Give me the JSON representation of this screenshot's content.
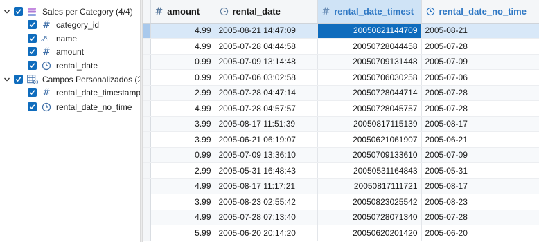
{
  "tree": {
    "groups": [
      {
        "label": "Sales per Category (4/4)",
        "fields": [
          {
            "label": "category_id",
            "icon": "hash-icon"
          },
          {
            "label": "name",
            "icon": "text-abc-icon"
          },
          {
            "label": "amount",
            "icon": "hash-icon"
          },
          {
            "label": "rental_date",
            "icon": "clock-icon"
          }
        ]
      },
      {
        "label": "Campos Personalizados (2/",
        "fields": [
          {
            "label": "rental_date_timestamp",
            "icon": "hash-icon"
          },
          {
            "label": "rental_date_no_time",
            "icon": "clock-icon"
          }
        ]
      }
    ]
  },
  "grid": {
    "columns": [
      {
        "label": "amount",
        "icon": "hash-icon"
      },
      {
        "label": "rental_date",
        "icon": "clock-icon"
      },
      {
        "label": "rental_date_timest",
        "icon": "hash-icon"
      },
      {
        "label": "rental_date_no_time",
        "icon": "clock-icon"
      }
    ],
    "rows": [
      [
        "4.99",
        "2005-08-21 14:47:09",
        "20050821144709",
        "2005-08-21"
      ],
      [
        "4.99",
        "2005-07-28 04:44:58",
        "20050728044458",
        "2005-07-28"
      ],
      [
        "0.99",
        "2005-07-09 13:14:48",
        "20050709131448",
        "2005-07-09"
      ],
      [
        "0.99",
        "2005-07-06 03:02:58",
        "20050706030258",
        "2005-07-06"
      ],
      [
        "2.99",
        "2005-07-28 04:47:14",
        "20050728044714",
        "2005-07-28"
      ],
      [
        "4.99",
        "2005-07-28 04:57:57",
        "20050728045757",
        "2005-07-28"
      ],
      [
        "3.99",
        "2005-08-17 11:51:39",
        "20050817115139",
        "2005-08-17"
      ],
      [
        "3.99",
        "2005-06-21 06:19:07",
        "20050621061907",
        "2005-06-21"
      ],
      [
        "0.99",
        "2005-07-09 13:36:10",
        "20050709133610",
        "2005-07-09"
      ],
      [
        "2.99",
        "2005-05-31 16:48:43",
        "20050531164843",
        "2005-05-31"
      ],
      [
        "4.99",
        "2005-08-17 11:17:21",
        "20050817111721",
        "2005-08-17"
      ],
      [
        "3.99",
        "2005-08-23 02:55:42",
        "20050823025542",
        "2005-08-23"
      ],
      [
        "4.99",
        "2005-07-28 07:13:40",
        "20050728071340",
        "2005-07-28"
      ],
      [
        "5.99",
        "2005-06-20 20:14:20",
        "20050620201420",
        "2005-06-20"
      ]
    ]
  },
  "colors": {
    "accent": "#0f6cbd",
    "selected_header_bg": "#cfe3f6",
    "selected_row_bg": "#d8e8f8"
  }
}
